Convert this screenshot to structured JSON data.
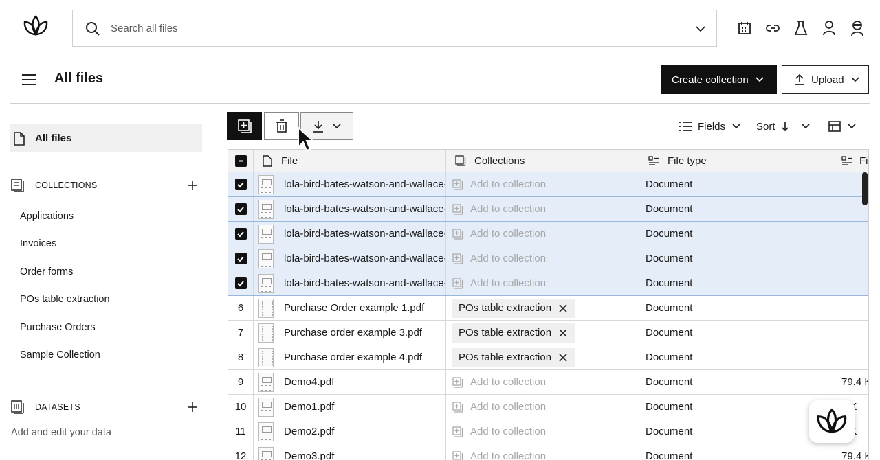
{
  "search": {
    "placeholder": "Search all files"
  },
  "header": {
    "title": "All files",
    "create_collection_label": "Create collection",
    "upload_label": "Upload"
  },
  "sidebar": {
    "all_files_label": "All files",
    "collections_heading": "COLLECTIONS",
    "collections": [
      "Applications",
      "Invoices",
      "Order forms",
      "POs table extraction",
      "Purchase Orders",
      "Sample Collection"
    ],
    "datasets_heading": "DATASETS",
    "datasets_desc": "Add and edit your data"
  },
  "toolbar": {
    "fields_label": "Fields",
    "sort_label": "Sort"
  },
  "table": {
    "columns": {
      "file": "File",
      "collections": "Collections",
      "file_type": "File type",
      "last": "Fi"
    },
    "rows": [
      {
        "index": "",
        "checked": true,
        "file": "lola-bird-bates-watson-and-wallace-",
        "collection": "Add to collection",
        "type": "Document",
        "size": ""
      },
      {
        "index": "",
        "checked": true,
        "file": "lola-bird-bates-watson-and-wallace-",
        "collection": "Add to collection",
        "type": "Document",
        "size": ""
      },
      {
        "index": "",
        "checked": true,
        "file": "lola-bird-bates-watson-and-wallace-",
        "collection": "Add to collection",
        "type": "Document",
        "size": ""
      },
      {
        "index": "",
        "checked": true,
        "file": "lola-bird-bates-watson-and-wallace-",
        "collection": "Add to collection",
        "type": "Document",
        "size": ""
      },
      {
        "index": "",
        "checked": true,
        "file": "lola-bird-bates-watson-and-wallace-",
        "collection": "Add to collection",
        "type": "Document",
        "size": ""
      },
      {
        "index": "6",
        "checked": false,
        "file": "Purchase Order example 1.pdf",
        "chip": "POs table extraction",
        "type": "Document",
        "size": ""
      },
      {
        "index": "7",
        "checked": false,
        "file": "Purchase order example 3.pdf",
        "chip": "POs table extraction",
        "type": "Document",
        "size": ""
      },
      {
        "index": "8",
        "checked": false,
        "file": "Purchase order example 4.pdf",
        "chip": "POs table extraction",
        "type": "Document",
        "size": ""
      },
      {
        "index": "9",
        "checked": false,
        "file": "Demo4.pdf",
        "collection": "Add to collection",
        "type": "Document",
        "size": "79.4 K"
      },
      {
        "index": "10",
        "checked": false,
        "file": "Demo1.pdf",
        "collection": "Add to collection",
        "type": "Document",
        "size": "4 K"
      },
      {
        "index": "11",
        "checked": false,
        "file": "Demo2.pdf",
        "collection": "Add to collection",
        "type": "Document",
        "size": "4 K"
      },
      {
        "index": "12",
        "checked": false,
        "file": "Demo3.pdf",
        "collection": "Add to collection",
        "type": "Document",
        "size": "79.4 K"
      }
    ]
  },
  "colors": {
    "selected_row": "#e5edf8",
    "primary_button": "#111111"
  }
}
